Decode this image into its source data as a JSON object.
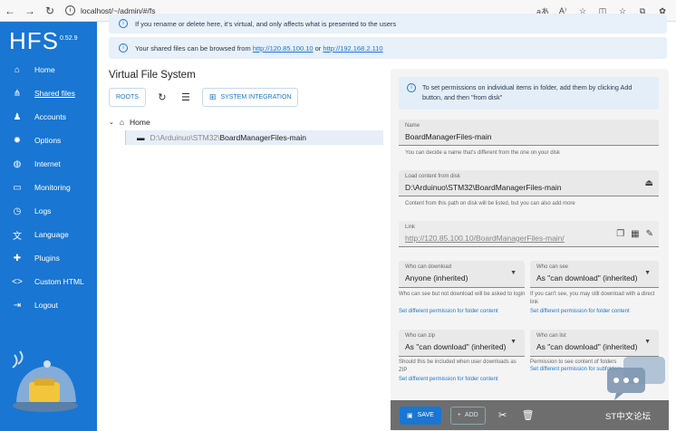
{
  "browser": {
    "url": "localhost/~/admin/#/fs",
    "back": "←",
    "forward": "→",
    "reload": "↻",
    "actions": [
      "aあ",
      "A⁾",
      "☆",
      "◫",
      "☆",
      "⧉",
      "✿"
    ]
  },
  "sidebar": {
    "logo": "HFS",
    "version": "0.52.9",
    "items": [
      {
        "label": "Home",
        "icon": "⌂"
      },
      {
        "label": "Shared files",
        "icon": "⋔"
      },
      {
        "label": "Accounts",
        "icon": "♟"
      },
      {
        "label": "Options",
        "icon": "✹"
      },
      {
        "label": "Internet",
        "icon": "◍"
      },
      {
        "label": "Monitoring",
        "icon": "▭"
      },
      {
        "label": "Logs",
        "icon": "◷"
      },
      {
        "label": "Language",
        "icon": "文"
      },
      {
        "label": "Plugins",
        "icon": "✚"
      },
      {
        "label": "Custom HTML",
        "icon": "<>"
      },
      {
        "label": "Logout",
        "icon": "⇥"
      }
    ]
  },
  "banners": {
    "rename": "If you rename or delete here, it's virtual, and only affects what is presented to the users",
    "browse_prefix": "Your shared files can be browsed from",
    "url1": "http://120.85.100.10",
    "or": "or",
    "url2": "http://192.168.2.110"
  },
  "vfs": {
    "title": "Virtual File System",
    "roots_label": "ROOTS",
    "system_integration_label": "SYSTEM INTEGRATION",
    "tree_root": "Home",
    "tree_child_path": "D:\\Arduinuo\\STM32\\",
    "tree_child_name": "BoardManagerFiles-main"
  },
  "panel": {
    "info": "To set permissions on individual items in folder, add them by clicking Add button, and then \"from disk\"",
    "name_label": "Name",
    "name_value": "BoardManagerFiles-main",
    "name_help": "You can decide a name that's different from the one on your disk",
    "source_label": "Load content from disk",
    "source_value": "D:\\Arduinuo\\STM32\\BoardManagerFiles-main",
    "source_help": "Content from this path on disk will be listed, but you can also add more",
    "link_label": "Link",
    "link_value": "http://120.85.100.10/BoardManagerFiles-main/",
    "who_download_label": "Who can download",
    "who_download_value": "Anyone (inherited)",
    "who_download_help": "Who can see but not download will be asked to login",
    "who_download_link": "Set different permission for folder content",
    "who_see_label": "Who can see",
    "who_see_value": "As \"can download\" (inherited)",
    "who_see_help": "If you can't see, you may still download with a direct link",
    "who_see_link": "Set different permission for folder content",
    "who_zip_label": "Who can zip",
    "who_zip_value": "As \"can download\" (inherited)",
    "who_zip_help": "Should this be included when user downloads as ZIP",
    "who_zip_link": "Set different permission for folder content",
    "who_list_label": "Who can list",
    "who_list_value": "As \"can download\" (inherited)",
    "who_list_help": "Permission to see content of folders",
    "who_list_link": "Set different permission for subfolders"
  },
  "footer": {
    "save_label": "SAVE",
    "add_label": "ADD",
    "watermark": "ST中文论坛"
  },
  "colors": {
    "sidebar": "#1976d2",
    "accent": "#1976d2",
    "panel_bg": "#f4f4f4",
    "bottombar": "#6e6e6e"
  }
}
